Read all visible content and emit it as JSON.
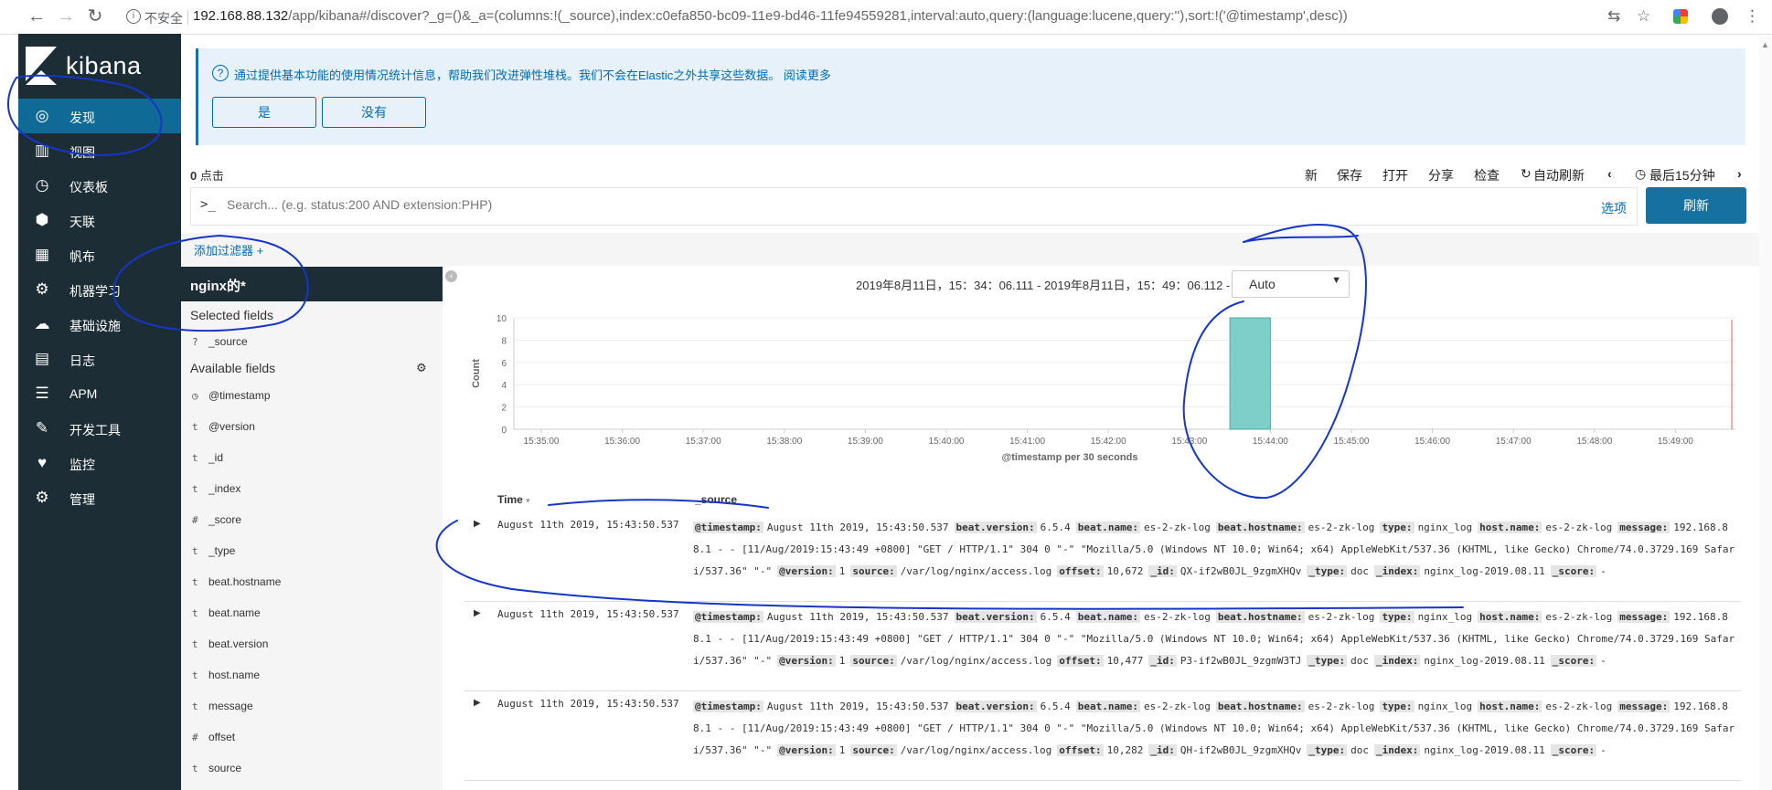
{
  "browser": {
    "insecure_label": "不安全",
    "url_host": "192.168.88.132",
    "url_path": "/app/kibana#/discover?_g=()&_a=(columns:!(_source),index:c0efa850-bc09-11e9-bd46-11fe94559281,interval:auto,query:(language:lucene,query:''),sort:!('@timestamp',desc))"
  },
  "sidebar": {
    "brand": "kibana",
    "items": [
      {
        "label": "发现",
        "icon": "compass-icon",
        "glyph": "◎"
      },
      {
        "label": "视图",
        "icon": "bar-chart-icon",
        "glyph": "▥"
      },
      {
        "label": "仪表板",
        "icon": "dashboard-icon",
        "glyph": "◷"
      },
      {
        "label": "天联",
        "icon": "canvas-icon",
        "glyph": "⬢"
      },
      {
        "label": "帆布",
        "icon": "maps-icon",
        "glyph": "▦"
      },
      {
        "label": "机器学习",
        "icon": "machine-learning-icon",
        "glyph": "⚙"
      },
      {
        "label": "基础设施",
        "icon": "infrastructure-icon",
        "glyph": "☁"
      },
      {
        "label": "日志",
        "icon": "logs-icon",
        "glyph": "▤"
      },
      {
        "label": "APM",
        "icon": "apm-icon",
        "glyph": "☰"
      },
      {
        "label": "开发工具",
        "icon": "wrench-icon",
        "glyph": "🔧"
      },
      {
        "label": "监控",
        "icon": "heartbeat-icon",
        "glyph": "♥"
      },
      {
        "label": "管理",
        "icon": "gear-icon",
        "glyph": "⚙"
      }
    ]
  },
  "notice": {
    "text": "通过提供基本功能的使用情况统计信息，帮助我们改进弹性堆栈。我们不会在Elastic之外共享这些数据。 阅读更多",
    "yes": "是",
    "no": "没有"
  },
  "toolbar": {
    "hits_count": "0",
    "hits_label": "点击",
    "links": [
      "新",
      "保存",
      "打开",
      "分享",
      "检查"
    ],
    "auto_refresh": "自动刷新",
    "time_picker": "最后15分钟"
  },
  "search": {
    "prompt": ">_",
    "placeholder": "Search... (e.g. status:200 AND extension:PHP)",
    "options": "选项",
    "refresh": "刷新"
  },
  "filter": {
    "add_filter": "添加过滤器 +"
  },
  "fields": {
    "index_pattern": "nginx的*",
    "selected_header": "Selected fields",
    "selected": [
      {
        "type": "?",
        "name": "_source"
      }
    ],
    "available_header": "Available fields",
    "available": [
      {
        "type": "◷",
        "name": "@timestamp"
      },
      {
        "type": "t",
        "name": "@version"
      },
      {
        "type": "t",
        "name": "_id"
      },
      {
        "type": "t",
        "name": "_index"
      },
      {
        "type": "#",
        "name": "_score"
      },
      {
        "type": "t",
        "name": "_type"
      },
      {
        "type": "t",
        "name": "beat.hostname"
      },
      {
        "type": "t",
        "name": "beat.name"
      },
      {
        "type": "t",
        "name": "beat.version"
      },
      {
        "type": "t",
        "name": "host.name"
      },
      {
        "type": "t",
        "name": "message"
      },
      {
        "type": "#",
        "name": "offset"
      },
      {
        "type": "t",
        "name": "source"
      }
    ]
  },
  "histogram": {
    "time_range": "2019年8月11日，15：34：06.111 - 2019年8月11日，15：49：06.112 -",
    "interval": "Auto"
  },
  "chart_data": {
    "type": "bar",
    "xlabel": "@timestamp per 30 seconds",
    "ylabel": "Count",
    "ylim": [
      0,
      10
    ],
    "yticks": [
      0,
      2,
      4,
      6,
      8,
      10
    ],
    "xticks": [
      "15:35:00",
      "15:36:00",
      "15:37:00",
      "15:38:00",
      "15:39:00",
      "15:40:00",
      "15:41:00",
      "15:42:00",
      "15:43:00",
      "15:44:00",
      "15:45:00",
      "15:46:00",
      "15:47:00",
      "15:48:00",
      "15:49:00"
    ],
    "bars": [
      {
        "x": "15:43:30",
        "value": 10
      }
    ],
    "bar_color": "#7dd0c9",
    "grid": true
  },
  "table": {
    "columns": [
      "Time",
      "_source"
    ],
    "rows": [
      {
        "time": "August 11th 2019, 15:43:50.537",
        "fields": [
          {
            "k": "@timestamp:",
            "v": "August 11th 2019, 15:43:50.537"
          },
          {
            "k": "beat.version:",
            "v": "6.5.4"
          },
          {
            "k": "beat.name:",
            "v": "es-2-zk-log"
          },
          {
            "k": "beat.hostname:",
            "v": "es-2-zk-log"
          },
          {
            "k": "type:",
            "v": "nginx_log"
          },
          {
            "k": "host.name:",
            "v": "es-2-zk-log"
          },
          {
            "k": "message:",
            "v": "192.168.88.1 - - [11/Aug/2019:15:43:49 +0800] \"GET / HTTP/1.1\" 304 0 \"-\" \"Mozilla/5.0 (Windows NT 10.0; Win64; x64) AppleWebKit/537.36 (KHTML, like Gecko) Chrome/74.0.3729.169 Safari/537.36\" \"-\""
          },
          {
            "k": "@version:",
            "v": "1"
          },
          {
            "k": "source:",
            "v": "/var/log/nginx/access.log"
          },
          {
            "k": "offset:",
            "v": "10,672"
          },
          {
            "k": "_id:",
            "v": "QX-if2wB0JL_9zgmXHQv"
          },
          {
            "k": "_type:",
            "v": "doc"
          },
          {
            "k": "_index:",
            "v": "nginx_log-2019.08.11"
          },
          {
            "k": "_score:",
            "v": "-"
          }
        ]
      },
      {
        "time": "August 11th 2019, 15:43:50.537",
        "fields": [
          {
            "k": "@timestamp:",
            "v": "August 11th 2019, 15:43:50.537"
          },
          {
            "k": "beat.version:",
            "v": "6.5.4"
          },
          {
            "k": "beat.name:",
            "v": "es-2-zk-log"
          },
          {
            "k": "beat.hostname:",
            "v": "es-2-zk-log"
          },
          {
            "k": "type:",
            "v": "nginx_log"
          },
          {
            "k": "host.name:",
            "v": "es-2-zk-log"
          },
          {
            "k": "message:",
            "v": "192.168.88.1 - - [11/Aug/2019:15:43:49 +0800] \"GET / HTTP/1.1\" 304 0 \"-\" \"Mozilla/5.0 (Windows NT 10.0; Win64; x64) AppleWebKit/537.36 (KHTML, like Gecko) Chrome/74.0.3729.169 Safari/537.36\" \"-\""
          },
          {
            "k": "@version:",
            "v": "1"
          },
          {
            "k": "source:",
            "v": "/var/log/nginx/access.log"
          },
          {
            "k": "offset:",
            "v": "10,477"
          },
          {
            "k": "_id:",
            "v": "P3-if2wB0JL_9zgmW3TJ"
          },
          {
            "k": "_type:",
            "v": "doc"
          },
          {
            "k": "_index:",
            "v": "nginx_log-2019.08.11"
          },
          {
            "k": "_score:",
            "v": "-"
          }
        ]
      },
      {
        "time": "August 11th 2019, 15:43:50.537",
        "fields": [
          {
            "k": "@timestamp:",
            "v": "August 11th 2019, 15:43:50.537"
          },
          {
            "k": "beat.version:",
            "v": "6.5.4"
          },
          {
            "k": "beat.name:",
            "v": "es-2-zk-log"
          },
          {
            "k": "beat.hostname:",
            "v": "es-2-zk-log"
          },
          {
            "k": "type:",
            "v": "nginx_log"
          },
          {
            "k": "host.name:",
            "v": "es-2-zk-log"
          },
          {
            "k": "message:",
            "v": "192.168.88.1 - - [11/Aug/2019:15:43:49 +0800] \"GET / HTTP/1.1\" 304 0 \"-\" \"Mozilla/5.0 (Windows NT 10.0; Win64; x64) AppleWebKit/537.36 (KHTML, like Gecko) Chrome/74.0.3729.169 Safari/537.36\" \"-\""
          },
          {
            "k": "@version:",
            "v": "1"
          },
          {
            "k": "source:",
            "v": "/var/log/nginx/access.log"
          },
          {
            "k": "offset:",
            "v": "10,282"
          },
          {
            "k": "_id:",
            "v": "QH-if2wB0JL_9zgmXHQv"
          },
          {
            "k": "_type:",
            "v": "doc"
          },
          {
            "k": "_index:",
            "v": "nginx_log-2019.08.11"
          },
          {
            "k": "_score:",
            "v": "-"
          }
        ]
      }
    ]
  }
}
